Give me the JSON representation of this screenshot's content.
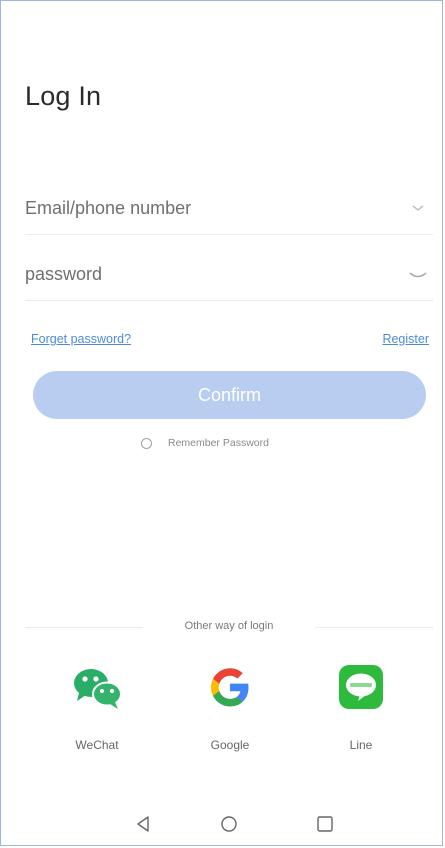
{
  "page": {
    "title": "Log In"
  },
  "form": {
    "email_placeholder": "Email/phone number",
    "password_placeholder": "password",
    "email_value": "",
    "password_value": "",
    "email_icon": "chevron-down-icon",
    "password_icon": "eye-closed-icon"
  },
  "links": {
    "forgot": "Forget password?",
    "register": "Register"
  },
  "confirm": {
    "label": "Confirm",
    "color": "#b9cdf0"
  },
  "remember": {
    "label": "Remember Password",
    "checked": false
  },
  "other_login": {
    "title": "Other way of login",
    "options": [
      {
        "label": "WeChat",
        "icon": "wechat-icon",
        "color": "#2aae67"
      },
      {
        "label": "Google",
        "icon": "google-icon",
        "color": "#4285f4"
      },
      {
        "label": "Line",
        "icon": "line-icon",
        "color": "#2dba3d"
      }
    ]
  },
  "system_nav": {
    "back_icon": "back-triangle-icon",
    "home_icon": "home-circle-icon",
    "recent_icon": "recent-square-icon"
  },
  "colors": {
    "accent": "#4a8bdc",
    "border": "#9db6d9"
  }
}
